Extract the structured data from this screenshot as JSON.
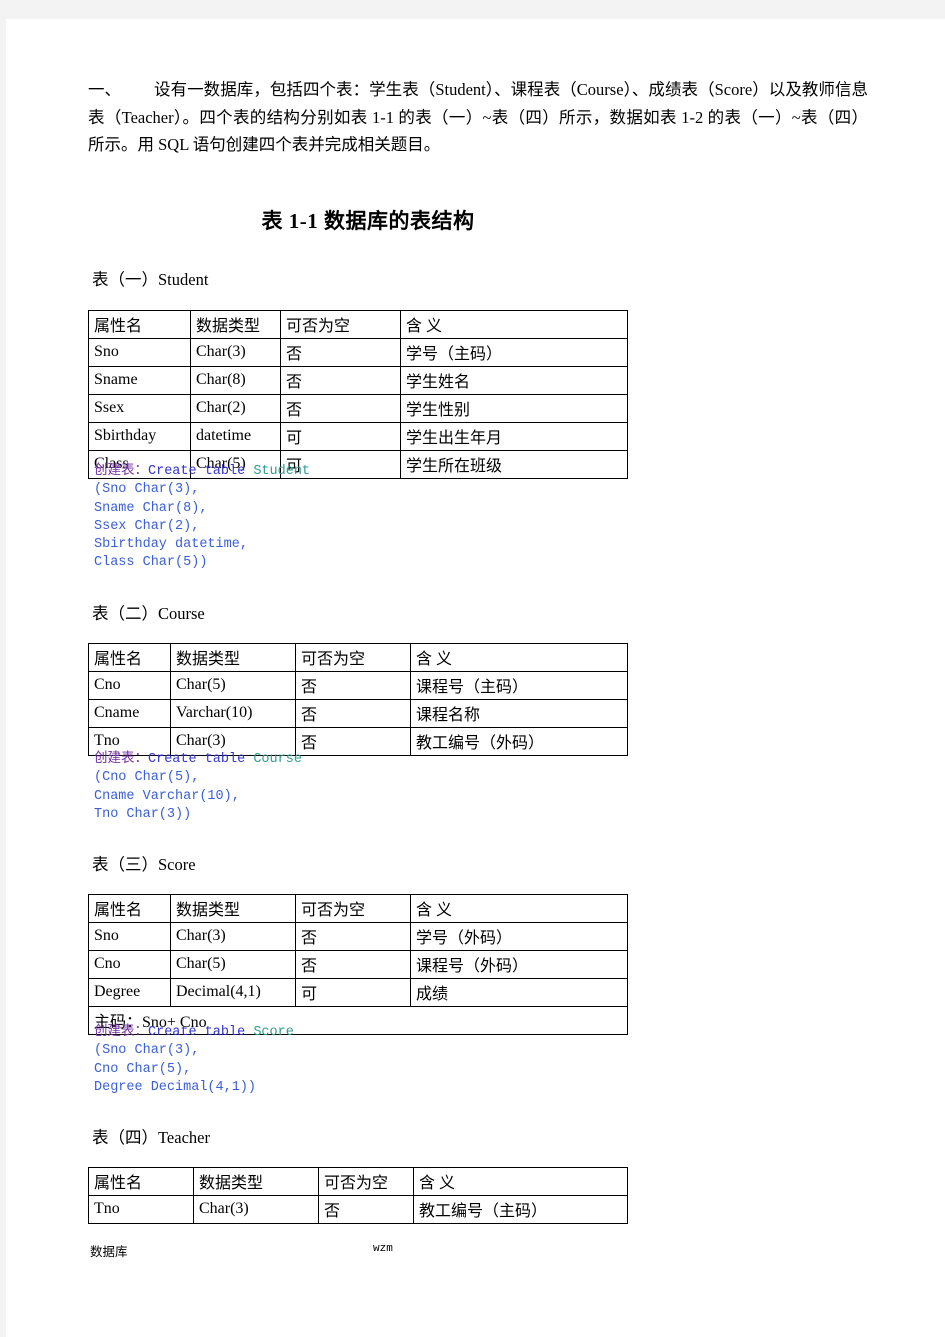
{
  "document": {
    "intro": {
      "number": "一、",
      "text": "设有一数据库，包括四个表：学生表（Student）、课程表（Course）、成绩表（Score）以及教师信息表（Teacher）。四个表的结构分别如表 1-1 的表（一）~表（四）所示，数据如表 1-2 的表（一）~表（四）所示。用 SQL 语句创建四个表并完成相关题目。"
    },
    "title": "表 1-1 数据库的表结构",
    "columns": [
      "属性名",
      "数据类型",
      "可否为空",
      "含 义"
    ],
    "sections": [
      {
        "caption": "表（一）Student",
        "rows": [
          [
            "Sno",
            "Char(3)",
            "否",
            "学号（主码）"
          ],
          [
            "Sname",
            "Char(8)",
            "否",
            "学生姓名"
          ],
          [
            "Ssex",
            "Char(2)",
            "否",
            "学生性别"
          ],
          [
            "Sbirthday",
            "datetime",
            "可",
            "学生出生年月"
          ],
          [
            "Class",
            "Char(5)",
            "可",
            "学生所在班级"
          ]
        ],
        "footer_row": null,
        "sql": {
          "label": "创建表：",
          "keyword": "Create table",
          "table": "Student",
          "lines": [
            "(Sno Char(3),",
            "Sname Char(8),",
            "Ssex Char(2),",
            "Sbirthday datetime,",
            "Class Char(5))"
          ]
        }
      },
      {
        "caption": "表（二）Course",
        "rows": [
          [
            "Cno",
            "Char(5)",
            "否",
            "课程号（主码）"
          ],
          [
            "Cname",
            "Varchar(10)",
            "否",
            "课程名称"
          ],
          [
            "Tno",
            "Char(3)",
            "否",
            "教工编号（外码）"
          ]
        ],
        "footer_row": null,
        "sql": {
          "label": "创建表：",
          "keyword": "Create table",
          "table": "Course",
          "lines": [
            "(Cno Char(5),",
            "Cname Varchar(10),",
            "Tno Char(3))"
          ]
        }
      },
      {
        "caption": "表（三）Score",
        "rows": [
          [
            "Sno",
            "Char(3)",
            "否",
            "学号（外码）"
          ],
          [
            "Cno",
            "Char(5)",
            "否",
            "课程号（外码）"
          ],
          [
            "Degree",
            "Decimal(4,1)",
            "可",
            "成绩"
          ]
        ],
        "footer_row": "主码：Sno+ Cno",
        "sql": {
          "label": "创建表：",
          "keyword": "Create table",
          "table": "Score",
          "lines": [
            "(Sno Char(3),",
            "Cno Char(5),",
            "Degree Decimal(4,1))"
          ]
        }
      },
      {
        "caption": "表（四）Teacher",
        "rows": [
          [
            "Tno",
            "Char(3)",
            "否",
            "教工编号（主码）"
          ]
        ],
        "footer_row": null,
        "sql": null
      }
    ],
    "footer": {
      "left": "数据库",
      "center": "wzm"
    }
  }
}
